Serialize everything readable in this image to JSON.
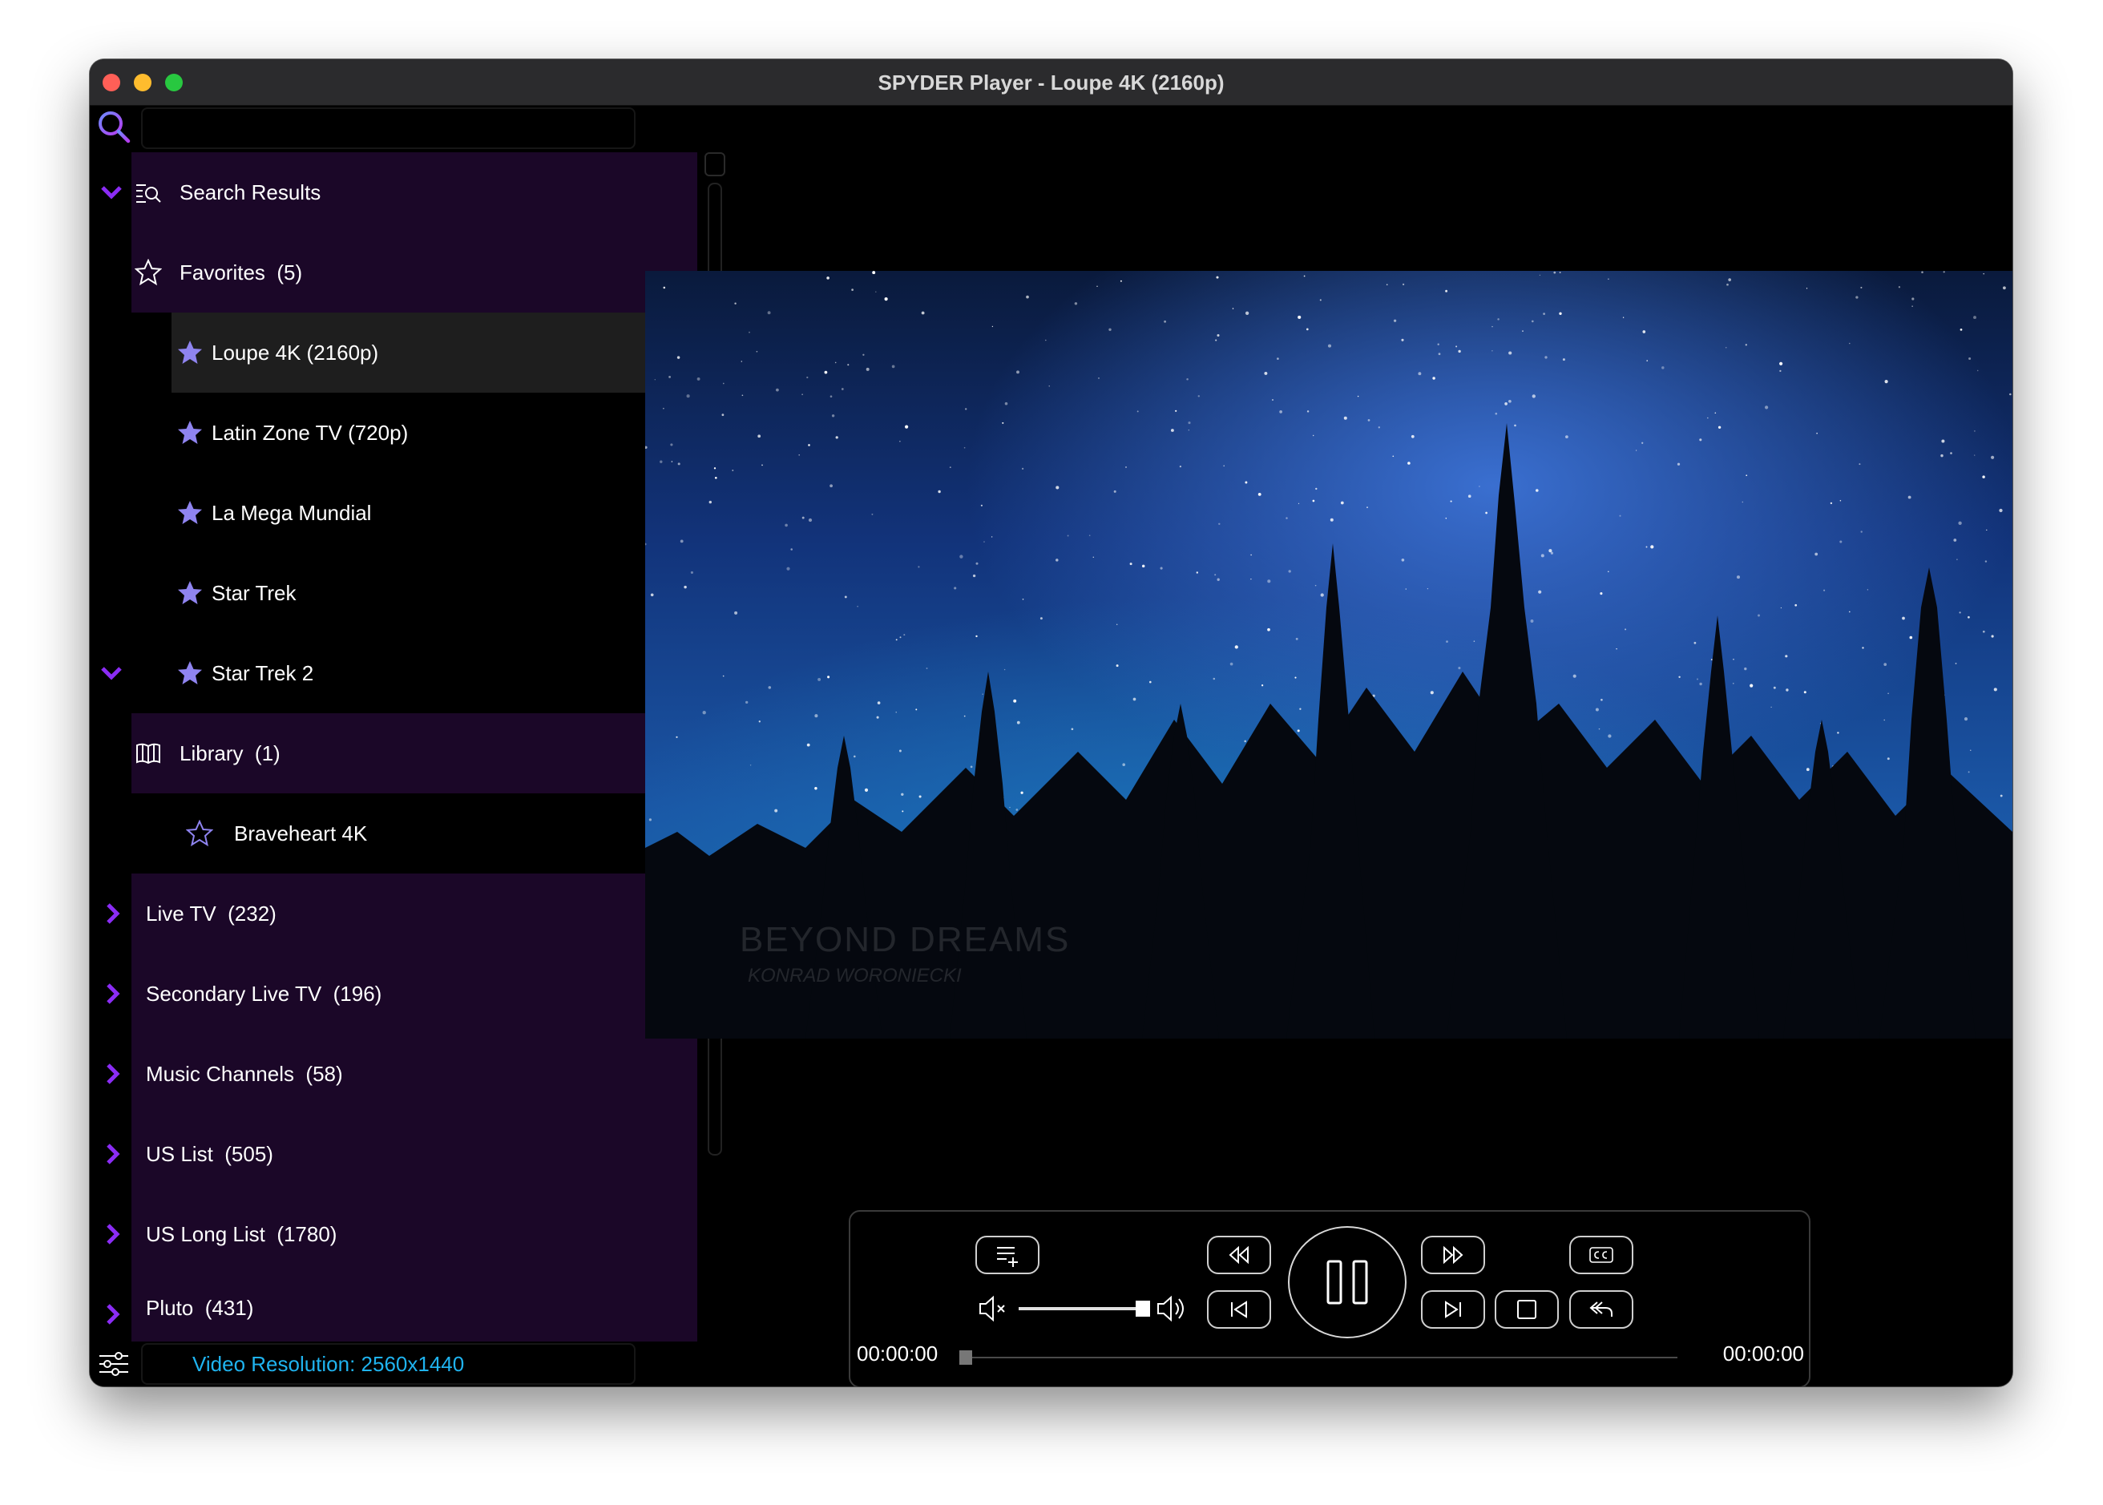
{
  "window": {
    "title": "SPYDER Player - Loupe 4K (2160p)"
  },
  "sidebar": {
    "search_placeholder": "",
    "items": [
      {
        "label": "Search Results",
        "kind": "section",
        "icon": "search-list-icon"
      },
      {
        "label": "Favorites  (5)",
        "kind": "section",
        "icon": "star-outline-icon",
        "expanded": true
      },
      {
        "label": "Loupe 4K (2160p)",
        "kind": "favorite",
        "icon": "star-filled-icon",
        "selected": true
      },
      {
        "label": "Latin Zone TV (720p)",
        "kind": "favorite",
        "icon": "star-filled-icon"
      },
      {
        "label": "La Mega Mundial",
        "kind": "favorite",
        "icon": "star-filled-icon"
      },
      {
        "label": "Star Trek",
        "kind": "favorite",
        "icon": "star-filled-icon"
      },
      {
        "label": "Star Trek 2",
        "kind": "favorite",
        "icon": "star-filled-icon"
      },
      {
        "label": "Library  (1)",
        "kind": "section",
        "icon": "book-icon",
        "expanded": true
      },
      {
        "label": "Braveheart 4K",
        "kind": "library",
        "icon": "star-outline-icon"
      },
      {
        "label": "Live TV  (232)",
        "kind": "group",
        "expanded": false
      },
      {
        "label": "Secondary Live TV  (196)",
        "kind": "group",
        "expanded": false
      },
      {
        "label": "Music Channels  (58)",
        "kind": "group",
        "expanded": false
      },
      {
        "label": "US List  (505)",
        "kind": "group",
        "expanded": false
      },
      {
        "label": "US Long List  (1780)",
        "kind": "group",
        "expanded": false
      },
      {
        "label": "Pluto  (431)",
        "kind": "group",
        "expanded": false
      }
    ]
  },
  "status": {
    "video_resolution": "Video Resolution: 2560x1440"
  },
  "video": {
    "watermark_title": "BEYOND DREAMS",
    "watermark_sub": "KONRAD WORONIECKI"
  },
  "player": {
    "time_elapsed": "00:00:00",
    "time_total": "00:00:00",
    "volume_level": 0.95,
    "seek_position": 0,
    "state": "playing"
  },
  "colors": {
    "accent_purple": "#8b2cf5",
    "section_bg": "#1b0728",
    "selected_bg": "#1e1e1e",
    "resolution_text": "#1fb3ef",
    "star_fill": "#8f84f0"
  }
}
